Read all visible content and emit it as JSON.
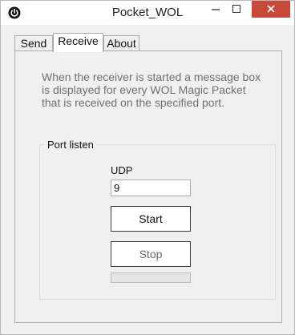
{
  "window": {
    "title": "Pocket_WOL",
    "app_icon": "power-icon",
    "controls": {
      "minimize": "minimize-icon",
      "maximize": "maximize-icon",
      "close": "close-icon"
    },
    "close_color": "#c7493a"
  },
  "tabs": [
    {
      "label": "Send",
      "active": false
    },
    {
      "label": "Receive",
      "active": true
    },
    {
      "label": "About",
      "active": false
    }
  ],
  "receive": {
    "description": "When the receiver is started a message box is displayed for every WOL Magic Packet that is received on the specified port.",
    "group_label": "Port listen",
    "protocol_label": "UDP",
    "port_value": "9",
    "start_label": "Start",
    "stop_label": "Stop",
    "progress_fraction": 0
  }
}
